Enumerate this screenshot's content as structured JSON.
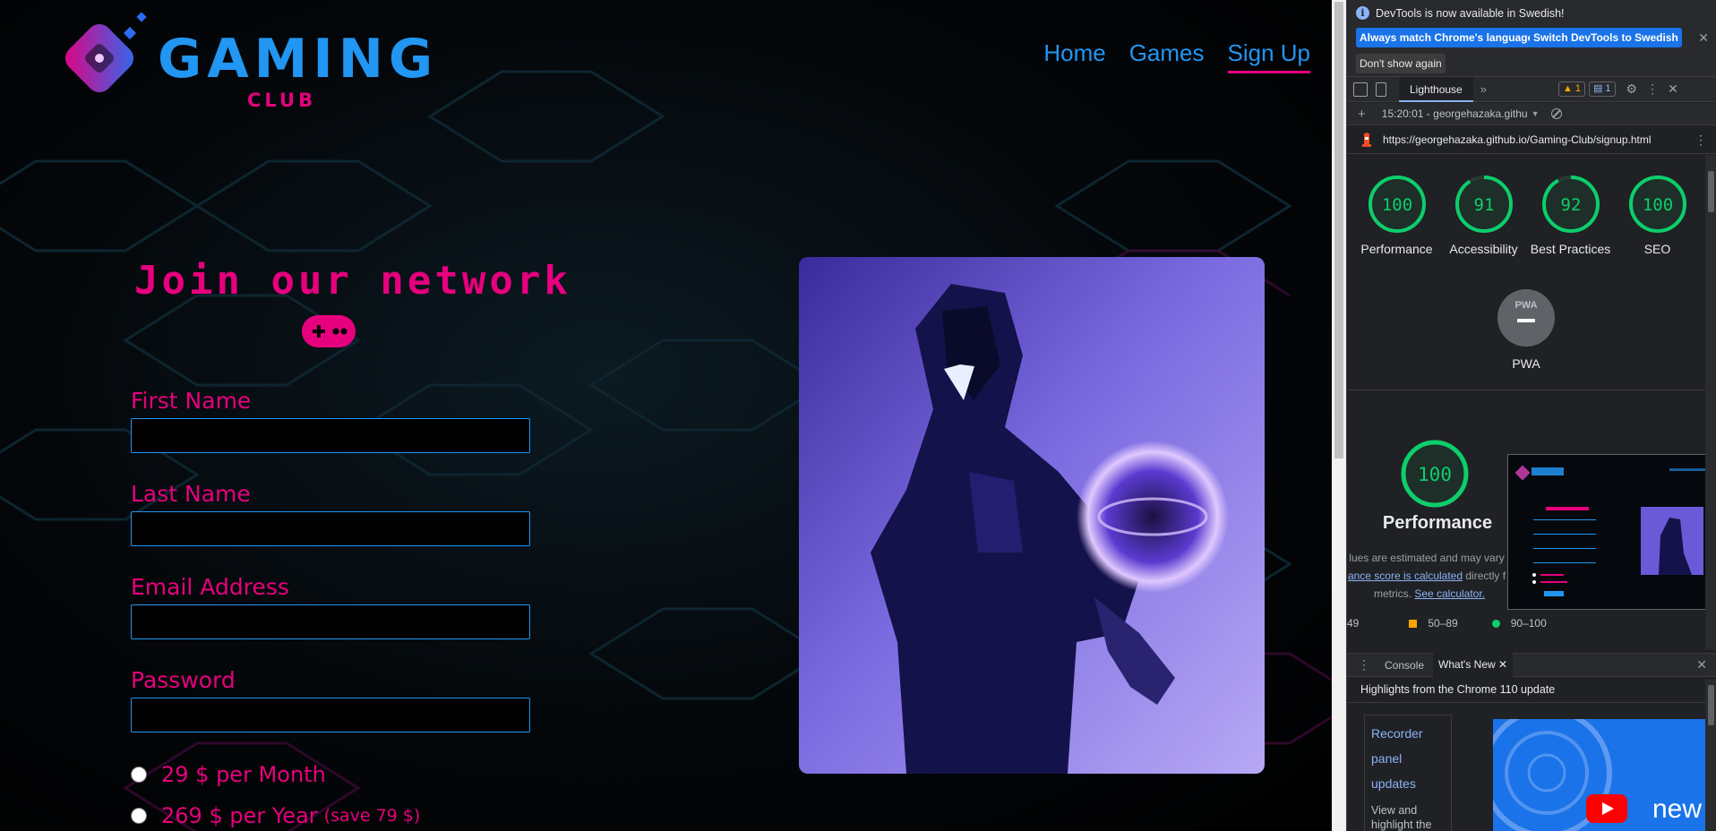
{
  "site": {
    "logo": {
      "title": "GAMING",
      "subtitle": "CLUB"
    },
    "nav": [
      {
        "label": "Home",
        "active": false
      },
      {
        "label": "Games",
        "active": false
      },
      {
        "label": "Sign Up",
        "active": true
      }
    ],
    "heading": "Join our network",
    "form": {
      "first_name": {
        "label": "First Name",
        "value": ""
      },
      "last_name": {
        "label": "Last Name",
        "value": ""
      },
      "email": {
        "label": "Email Address",
        "value": ""
      },
      "password": {
        "label": "Password",
        "value": ""
      },
      "plans": [
        {
          "label": "29 $ per Month",
          "note": "",
          "selected": false
        },
        {
          "label": "269 $ per Year",
          "note": "(save 79 $)",
          "selected": false
        }
      ]
    },
    "colors": {
      "pink": "#e6007e",
      "blue": "#2196f3",
      "background": "#000000"
    }
  },
  "devtools": {
    "infobar": {
      "message": "DevTools is now available in Swedish!",
      "btn_match": "Always match Chrome's language",
      "btn_switch": "Switch DevTools to Swedish",
      "btn_dismiss": "Don't show again"
    },
    "tabs": {
      "active": "Lighthouse",
      "warnings": "1",
      "messages": "1"
    },
    "report_select": "15:20:01 - georgehazaka.githu",
    "url": "https://georgehazaka.github.io/Gaming-Club/signup.html",
    "scores": [
      {
        "label": "Performance",
        "value": "100",
        "score": 100
      },
      {
        "label": "Accessibility",
        "value": "91",
        "score": 91
      },
      {
        "label": "Best Practices",
        "value": "92",
        "score": 92
      },
      {
        "label": "SEO",
        "value": "100",
        "score": 100
      }
    ],
    "pwa": {
      "badge": "PWA",
      "label": "PWA"
    },
    "performance": {
      "score": "100",
      "title": "Performance",
      "note_line1": "lues are estimated and may vary",
      "note_link": "ance score is calculated",
      "note_line2_rest": " directly f",
      "note_line3": "metrics.",
      "calc_link": "See calculator."
    },
    "legend": {
      "low": "49",
      "mid": "50–89",
      "high": "90–100"
    },
    "drawer": {
      "tabs": [
        "Console",
        "What's New"
      ],
      "highlight": "Highlights from the Chrome 110 update",
      "card_links": [
        "Recorder",
        "panel",
        "updates"
      ],
      "card_text": "View and highlight the code of your",
      "video_text": "new"
    },
    "colors": {
      "pass": "#0cce6b",
      "average": "#ffa400",
      "link": "#8ab4f8",
      "accent": "#1a73e8"
    }
  }
}
